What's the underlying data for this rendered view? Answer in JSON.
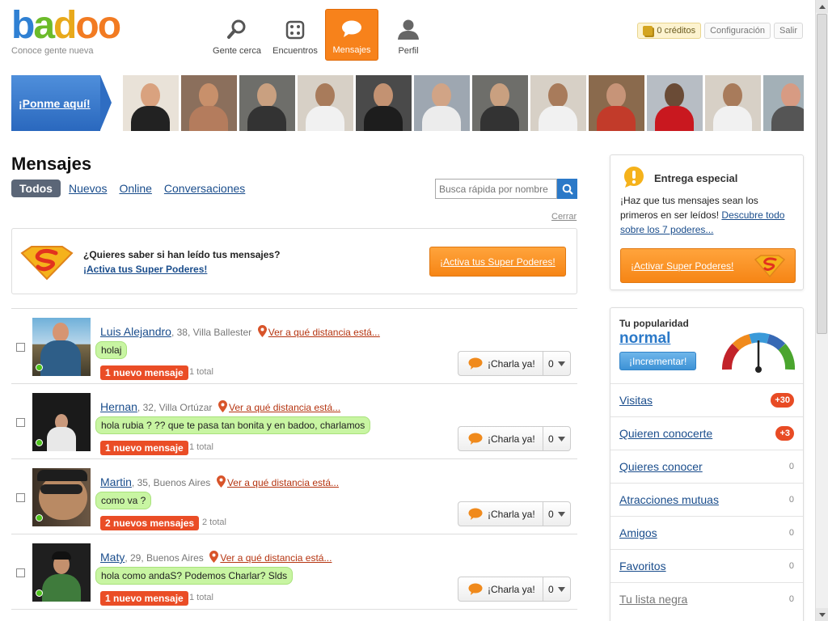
{
  "header": {
    "logo_letters": [
      "b",
      "a",
      "d",
      "o",
      "o"
    ],
    "logo_colors": [
      "#2f80d3",
      "#6cbb2a",
      "#e8a91b",
      "#f27b22",
      "#f27b22"
    ],
    "tagline": "Conoce gente nueva",
    "nav": [
      {
        "label": "Gente cerca",
        "icon": "search-icon",
        "active": false
      },
      {
        "label": "Encuentros",
        "icon": "dice-icon",
        "active": false
      },
      {
        "label": "Mensajes",
        "icon": "chat-bubble-icon",
        "active": true
      },
      {
        "label": "Perfil",
        "icon": "user-icon",
        "active": false
      }
    ],
    "credits": "0 créditos",
    "settings": "Configuración",
    "logout": "Salir"
  },
  "strip": {
    "cta": "¡Ponme aquí!",
    "thumb_count": 12
  },
  "page": {
    "title": "Mensajes",
    "tabs": {
      "active": "Todos",
      "others": [
        "Nuevos",
        "Online",
        "Conversaciones"
      ]
    },
    "search_placeholder": "Busca rápida por nombre",
    "close_label": "Cerrar"
  },
  "promo": {
    "question": "¿Quieres saber si han leído tus mensajes?",
    "link": "¡Activa tus Super Poderes!",
    "button": "¡Activa tus Super Poderes!"
  },
  "messages": [
    {
      "name": "Luis Alejandro",
      "meta": ", 38, Villa Ballester",
      "distance": "Ver a qué distancia está...",
      "message": "holaj",
      "new": "1 nuevo mensaje",
      "total": "1 total",
      "chat": "¡Charla ya!",
      "count": "0"
    },
    {
      "name": "Hernan",
      "meta": ", 32, Villa Ortúzar",
      "distance": "Ver a qué distancia está...",
      "message": "hola rubia ? ?? que te pasa tan bonita y en badoo, charlamos",
      "new": "1 nuevo mensaje",
      "total": "1 total",
      "chat": "¡Charla ya!",
      "count": "0"
    },
    {
      "name": "Martin",
      "meta": ", 35, Buenos Aires",
      "distance": "Ver a qué distancia está...",
      "message": "como va ?",
      "new": "2 nuevos mensajes",
      "total": "2 total",
      "chat": "¡Charla ya!",
      "count": "0"
    },
    {
      "name": "Maty",
      "meta": ", 29, Buenos Aires",
      "distance": "Ver a qué distancia está...",
      "message": "hola como andaS? Podemos Charlar? Slds",
      "new": "1 nuevo mensaje",
      "total": "1 total",
      "chat": "¡Charla ya!",
      "count": "0"
    }
  ],
  "special": {
    "title": "Entrega especial",
    "text": "¡Haz que tus mensajes sean los primeros en ser leídos!",
    "link": "Descubre todo sobre los 7 poderes...",
    "button": "¡Activar Super Poderes!"
  },
  "popularity": {
    "label": "Tu popularidad",
    "value": "normal",
    "button": "¡Incrementar!",
    "stats": [
      {
        "label": "Visitas",
        "value": "+30",
        "badge": true
      },
      {
        "label": "Quieren conocerte",
        "value": "+3",
        "badge": true
      },
      {
        "label": "Quieres conocer",
        "value": "0",
        "badge": false
      },
      {
        "label": "Atracciones mutuas",
        "value": "0",
        "badge": false
      },
      {
        "label": "Amigos",
        "value": "0",
        "badge": false
      },
      {
        "label": "Favoritos",
        "value": "0",
        "badge": false
      },
      {
        "label": "Tu lista negra",
        "value": "0",
        "badge": false
      }
    ]
  },
  "colors": {
    "accent": "#f7821b",
    "link": "#1a4d8c",
    "badge": "#ea4d26",
    "bubble": "#c8f5a2"
  }
}
